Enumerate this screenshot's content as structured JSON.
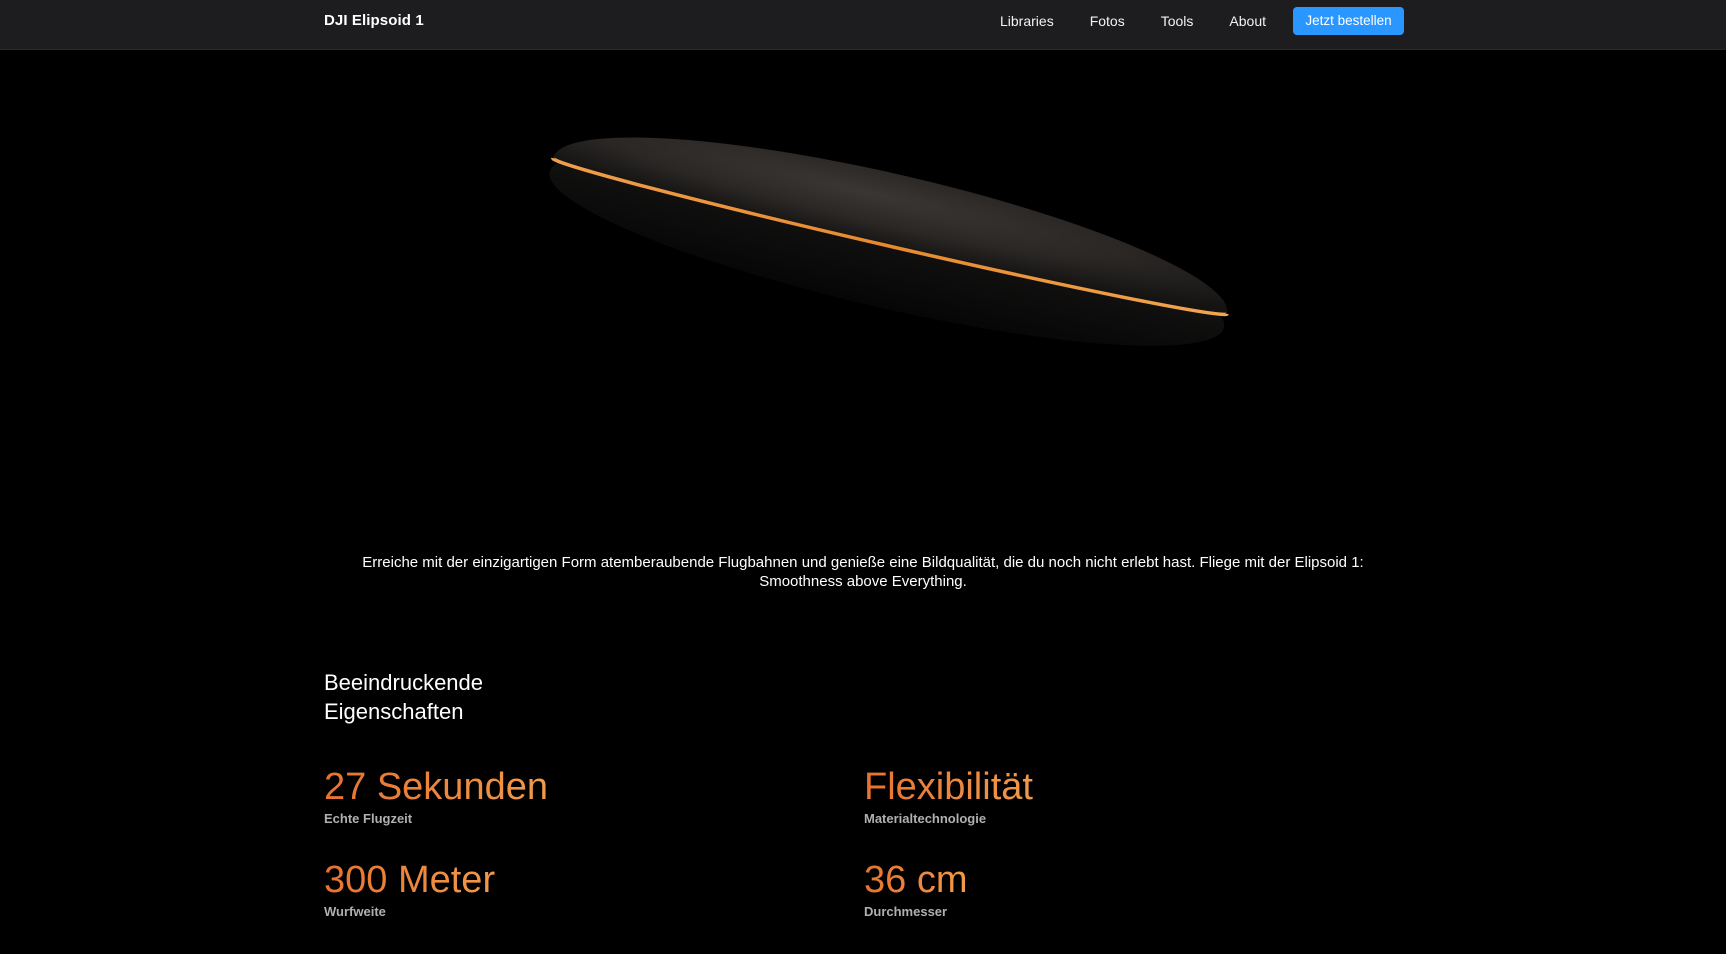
{
  "nav": {
    "brand": "DJI Elipsoid 1",
    "links": [
      "Libraries",
      "Fotos",
      "Tools",
      "About"
    ],
    "cta_label": "Jetzt bestellen"
  },
  "hero": {
    "tagline": "Erreiche mit der einzigartigen Form atemberaubende Flugbahnen und genieße eine Bildqualität, die du noch nicht erlebt hast. Fliege mit der Elipsoid 1: Smoothness above Everything."
  },
  "features": {
    "title": "Beeindruckende Eigenschaften",
    "items": [
      {
        "value": "27 Sekunden",
        "label": "Echte Flugzeit"
      },
      {
        "value": "Flexibilität",
        "label": "Materialtechnologie"
      },
      {
        "value": "300 Meter",
        "label": "Wurfweite"
      },
      {
        "value": "36 cm",
        "label": "Durchmesser"
      }
    ]
  },
  "colors": {
    "accent_orange": "#f0913f",
    "cta_blue": "#2997ff",
    "nav_bg": "#1d1d1f",
    "page_bg": "#000000"
  }
}
